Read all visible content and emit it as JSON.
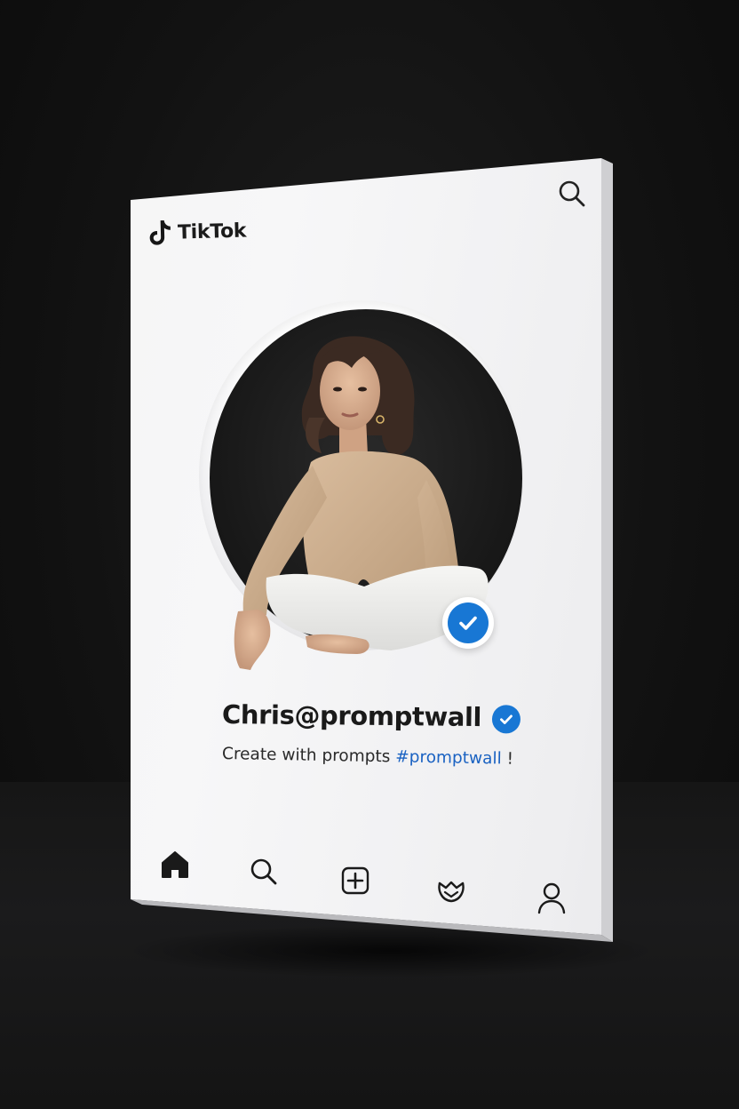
{
  "app": {
    "name": "TikTok"
  },
  "profile": {
    "username": "Chris@promptwall",
    "verified": true,
    "bio_text": "Create with prompts ",
    "bio_hashtag": "#promptwall",
    "bio_suffix": " !"
  },
  "icons": {
    "logo": "tiktok-note-icon",
    "top_search": "search-icon",
    "nav": [
      "home-icon",
      "search-icon",
      "add-icon",
      "inbox-icon",
      "profile-icon"
    ]
  },
  "colors": {
    "verified_blue": "#1877d4",
    "hashtag_blue": "#1a62c2",
    "panel_white": "#f4f4f4",
    "background": "#121212"
  }
}
